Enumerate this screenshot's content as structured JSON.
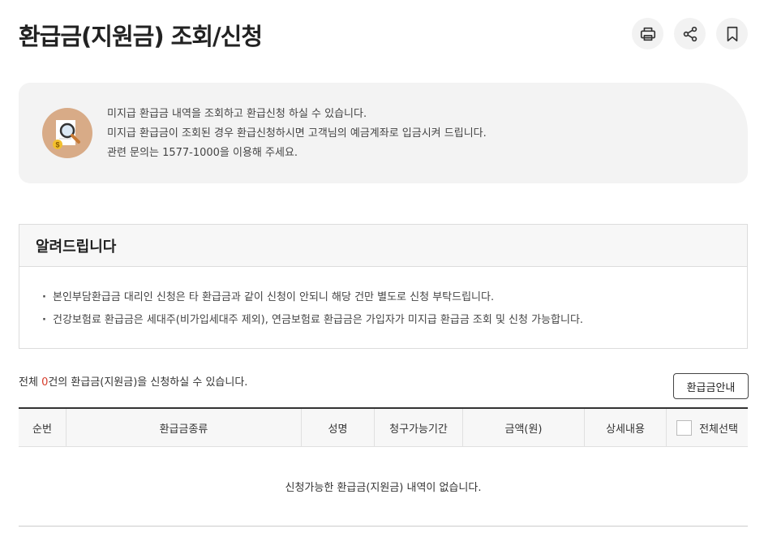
{
  "page": {
    "title": "환급금(지원금) 조회/신청",
    "actions": [
      {
        "icon": "print-icon",
        "label": ""
      },
      {
        "icon": "share-icon",
        "label": ""
      },
      {
        "icon": "bookmark-icon",
        "label": ""
      }
    ]
  },
  "info": {
    "lines": [
      "미지급 환급금 내역을 조회하고 환급신청 하실 수 있습니다.",
      "미지급 환급금이 조회된 경우 환급신청하시면 고객님의 예금계좌로 입금시켜 드립니다.",
      "관련 문의는 1577-1000을 이용해 주세요."
    ],
    "icon": "document-search-icon"
  },
  "notice": {
    "title": "알려드립니다",
    "items": [
      "본인부담환급금 대리인 신청은 타 환급금과 같이 신청이 안되니 해당 건만 별도로 신청 부탁드립니다.",
      "건강보험료 환급금은 세대주(비가입세대주 제외), 연금보험료 환급금은 가입자가 미지급 환급금 조회 및 신청 가능합니다."
    ]
  },
  "summary": {
    "prefix": "전체 ",
    "count": "0",
    "suffix": "건의 환급금(지원금)을 신청하실 수 있습니다."
  },
  "guide_button": "환급금안내",
  "table": {
    "columns": [
      "순번",
      "환급금종류",
      "성명",
      "청구가능기간",
      "금액(원)",
      "상세내용",
      "전체선택"
    ],
    "empty_message": "신청가능한 환급금(지원금) 내역이 없습니다."
  },
  "colors": {
    "accent_red": "#d63c2b",
    "icon_circle": "#d8ab87",
    "info_bg": "#f3f3f3"
  }
}
